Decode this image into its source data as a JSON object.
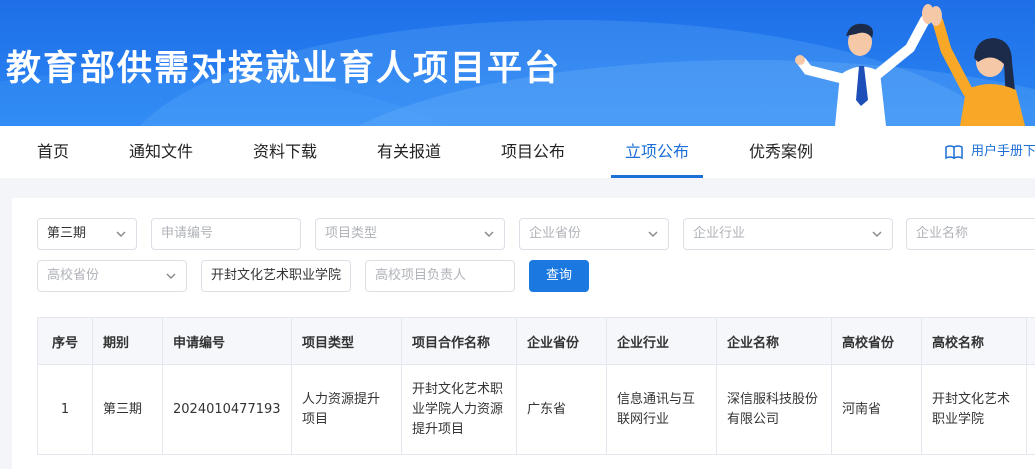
{
  "banner": {
    "title": "教育部供需对接就业育人项目平台"
  },
  "nav": {
    "items": [
      "首页",
      "通知文件",
      "资料下载",
      "有关报道",
      "项目公布",
      "立项公布",
      "优秀案例"
    ],
    "active_index": 5,
    "manual_label": "用户手册下"
  },
  "filters": {
    "period_value": "第三期",
    "apply_no_placeholder": "申请编号",
    "project_type_placeholder": "项目类型",
    "company_province_placeholder": "企业省份",
    "company_industry_placeholder": "企业行业",
    "company_name_placeholder": "企业名称",
    "school_province_placeholder": "高校省份",
    "school_name_value": "开封文化艺术职业学院",
    "school_leader_placeholder": "高校项目负责人",
    "query_label": "查询"
  },
  "table": {
    "headers": [
      "序号",
      "期别",
      "申请编号",
      "项目类型",
      "项目合作名称",
      "企业省份",
      "企业行业",
      "企业名称",
      "高校省份",
      "高校名称"
    ],
    "rows": [
      [
        "1",
        "第三期",
        "2024010477193",
        "人力资源提升项目",
        "开封文化艺术职业学院人力资源提升项目",
        "广东省",
        "信息通讯与互联网行业",
        "深信服科技股份有限公司",
        "河南省",
        "开封文化艺术职业学院"
      ]
    ]
  },
  "colors": {
    "primary": "#1b78e0",
    "banner": "#2a86f3",
    "active_nav": "#1b6fd6"
  }
}
